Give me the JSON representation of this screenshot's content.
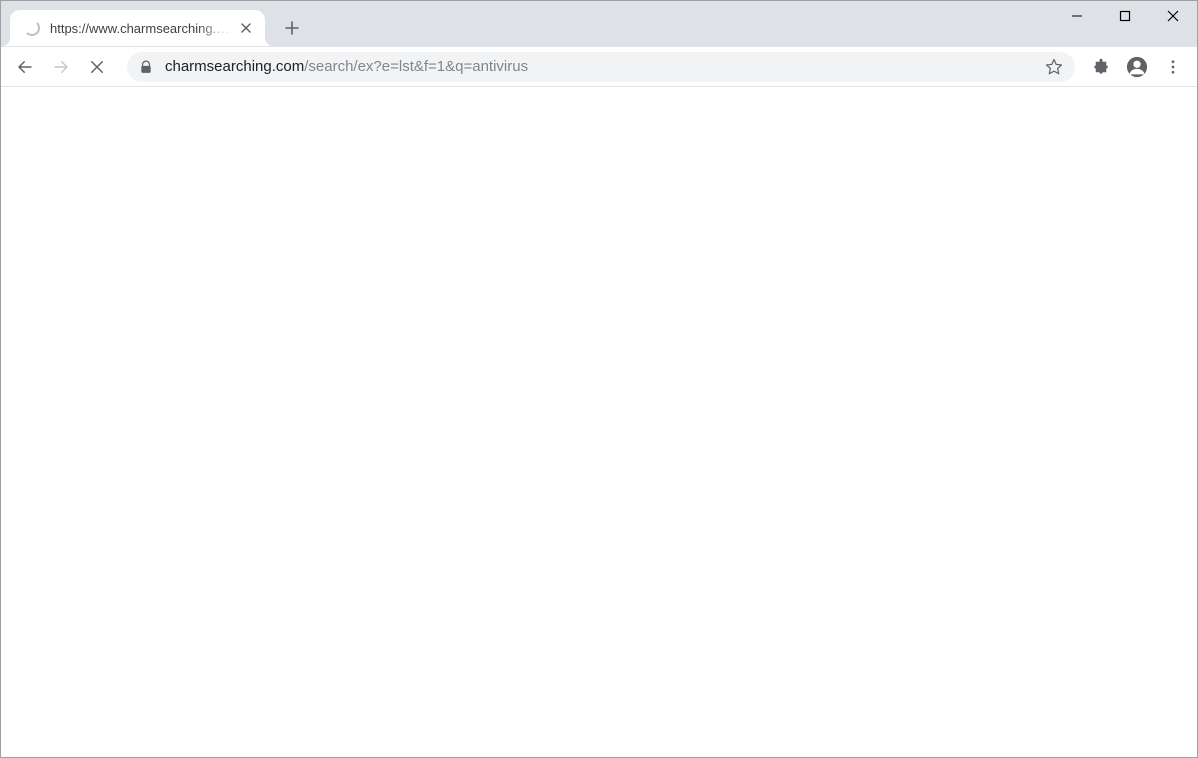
{
  "tab": {
    "title": "https://www.charmsearching.com"
  },
  "url": {
    "host": "charmsearching.com",
    "path": "/search/ex?e=lst&f=1&q=antivirus"
  },
  "colors": {
    "titlebar_bg": "#dee1e6",
    "tab_bg": "#ffffff",
    "omnibox_bg": "#f1f3f4",
    "url_host": "#202124",
    "url_path": "#80868b",
    "icon_dark": "#5f6368"
  }
}
